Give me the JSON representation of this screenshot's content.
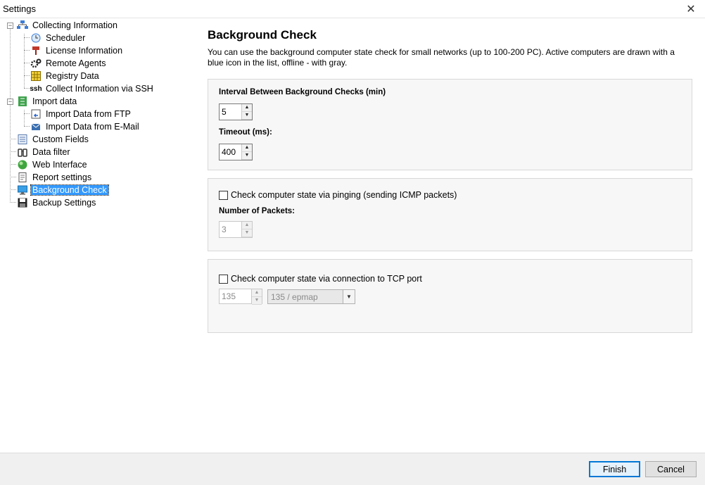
{
  "window": {
    "title": "Settings",
    "close_glyph": "✕"
  },
  "tree": {
    "items": [
      {
        "label": "Collecting Information",
        "icon": "network-icon"
      },
      {
        "label": "Scheduler",
        "icon": "clock-icon"
      },
      {
        "label": "License Information",
        "icon": "license-icon"
      },
      {
        "label": "Remote Agents",
        "icon": "gears-icon"
      },
      {
        "label": "Registry Data",
        "icon": "registry-grid-icon"
      },
      {
        "label": "Collect Information via SSH",
        "icon": "ssh-icon",
        "icon_text": "ssh"
      },
      {
        "label": "Import data",
        "icon": "import-icon"
      },
      {
        "label": "Import Data from FTP",
        "icon": "ftp-import-icon"
      },
      {
        "label": "Import Data from E-Mail",
        "icon": "email-import-icon"
      },
      {
        "label": "Custom Fields",
        "icon": "custom-fields-icon"
      },
      {
        "label": "Data filter",
        "icon": "binoculars-icon"
      },
      {
        "label": "Web Interface",
        "icon": "globe-icon"
      },
      {
        "label": "Report settings",
        "icon": "report-icon"
      },
      {
        "label": "Background Check",
        "icon": "monitor-icon",
        "selected": true
      },
      {
        "label": "Backup Settings",
        "icon": "floppy-disk-icon"
      }
    ]
  },
  "main": {
    "heading": "Background Check",
    "description": "You can use the background computer state check for small networks (up to 100-200 PC). Active computers are drawn with a blue icon in the list, offline - with gray.",
    "interval": {
      "label": "Interval Between Background Checks (min)",
      "value": "5"
    },
    "timeout": {
      "label": "Timeout (ms):",
      "value": "400"
    },
    "ping": {
      "checkbox_label": "Check computer state via pinging (sending ICMP packets)",
      "checked": false,
      "packets_label": "Number of Packets:",
      "packets_value": "3"
    },
    "tcp": {
      "checkbox_label": "Check computer state via connection to TCP port",
      "checked": false,
      "port_value": "135",
      "port_selected": "135 / epmap"
    }
  },
  "footer": {
    "finish_label": "Finish",
    "cancel_label": "Cancel"
  },
  "colors": {
    "selection": "#3399ff",
    "default_button_border": "#0078d7"
  }
}
